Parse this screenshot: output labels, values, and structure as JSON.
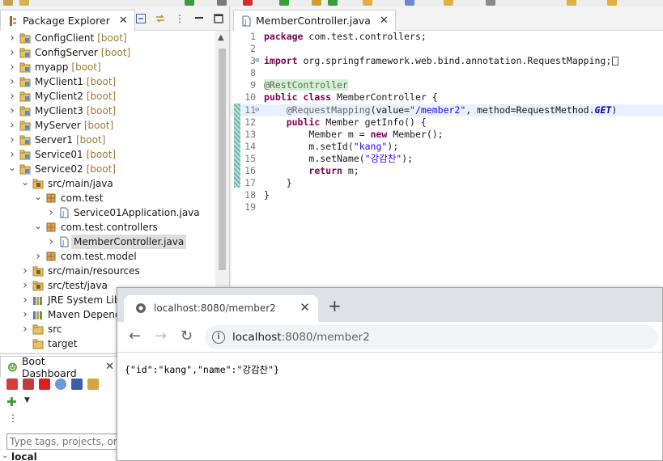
{
  "package_explorer": {
    "tab_label": "Package Explorer",
    "items": [
      {
        "label": "ConfigClient",
        "decoration": "[boot]",
        "indent": 0,
        "state": "collapsed",
        "icon": "project-icon"
      },
      {
        "label": "ConfigServer",
        "decoration": "[boot]",
        "indent": 0,
        "state": "collapsed",
        "icon": "project-icon"
      },
      {
        "label": "myapp",
        "decoration": "[boot]",
        "indent": 0,
        "state": "collapsed",
        "icon": "project-icon"
      },
      {
        "label": "MyClient1",
        "decoration": "[boot]",
        "indent": 0,
        "state": "collapsed",
        "icon": "project-icon"
      },
      {
        "label": "MyClient2",
        "decoration": "[boot]",
        "indent": 0,
        "state": "collapsed",
        "icon": "project-icon"
      },
      {
        "label": "MyClient3",
        "decoration": "[boot]",
        "indent": 0,
        "state": "collapsed",
        "icon": "project-icon"
      },
      {
        "label": "MyServer",
        "decoration": "[boot]",
        "indent": 0,
        "state": "collapsed",
        "icon": "project-icon"
      },
      {
        "label": "Server1",
        "decoration": "[boot]",
        "indent": 0,
        "state": "collapsed",
        "icon": "project-icon"
      },
      {
        "label": "Service01",
        "decoration": "[boot]",
        "indent": 0,
        "state": "collapsed",
        "icon": "project-icon"
      },
      {
        "label": "Service02",
        "decoration": "[boot]",
        "indent": 0,
        "state": "expanded",
        "icon": "project-icon"
      },
      {
        "label": "src/main/java",
        "decoration": "",
        "indent": 1,
        "state": "expanded",
        "icon": "source-folder-icon"
      },
      {
        "label": "com.test",
        "decoration": "",
        "indent": 2,
        "state": "expanded",
        "icon": "package-icon"
      },
      {
        "label": "Service01Application.java",
        "decoration": "",
        "indent": 3,
        "state": "collapsed",
        "icon": "java-file-icon"
      },
      {
        "label": "com.test.controllers",
        "decoration": "",
        "indent": 2,
        "state": "expanded",
        "icon": "package-icon"
      },
      {
        "label": "MemberController.java",
        "decoration": "",
        "indent": 3,
        "state": "collapsed",
        "icon": "java-file-icon",
        "selected": true
      },
      {
        "label": "com.test.model",
        "decoration": "",
        "indent": 2,
        "state": "collapsed",
        "icon": "package-icon"
      },
      {
        "label": "src/main/resources",
        "decoration": "",
        "indent": 1,
        "state": "collapsed",
        "icon": "source-folder-icon"
      },
      {
        "label": "src/test/java",
        "decoration": "",
        "indent": 1,
        "state": "collapsed",
        "icon": "source-folder-icon"
      },
      {
        "label": "JRE System Libra",
        "decoration": "",
        "indent": 1,
        "state": "collapsed",
        "icon": "library-icon"
      },
      {
        "label": "Maven Depende",
        "decoration": "",
        "indent": 1,
        "state": "collapsed",
        "icon": "library-icon"
      },
      {
        "label": "src",
        "decoration": "",
        "indent": 1,
        "state": "collapsed",
        "icon": "folder-icon"
      },
      {
        "label": "target",
        "decoration": "",
        "indent": 1,
        "state": "none",
        "icon": "folder-icon"
      }
    ]
  },
  "boot_dashboard": {
    "tab_label": "Boot Dashboard",
    "filter_placeholder": "Type tags, projects, or wo",
    "local_label": "local"
  },
  "editor": {
    "tab_label": "MemberController.java",
    "lines": [
      {
        "n": "1",
        "parts": [
          [
            "kw",
            "package"
          ],
          [
            "",
            "com.test.controllers;"
          ]
        ]
      },
      {
        "n": "2",
        "parts": []
      },
      {
        "n": "3",
        "fold": "⊕",
        "parts": [
          [
            "kw",
            "import"
          ],
          [
            "",
            "org.springframework.web.bind.annotation.RequestMapping;"
          ]
        ],
        "ext": true
      },
      {
        "n": "8",
        "parts": []
      },
      {
        "n": "9",
        "parts": [
          [
            "ann",
            "@RestController"
          ]
        ]
      },
      {
        "n": "10",
        "parts": [
          [
            "kw",
            "public"
          ],
          [
            "",
            ""
          ],
          [
            "kw",
            "class"
          ],
          [
            "",
            "MemberController {"
          ]
        ]
      },
      {
        "n": "11",
        "fold": "⊖",
        "hl": true,
        "indent": "    ",
        "parts": [
          [
            "ann2",
            "@RequestMapping"
          ],
          [
            "",
            "(value="
          ],
          [
            "str",
            "\"/member2\""
          ],
          [
            "",
            ", method=RequestMethod."
          ],
          [
            "ital",
            "GET"
          ],
          [
            "",
            ")"
          ]
        ]
      },
      {
        "n": "12",
        "indent": "    ",
        "parts": [
          [
            "kw",
            "public"
          ],
          [
            "",
            "Member getInfo() {"
          ]
        ]
      },
      {
        "n": "13",
        "indent": "        ",
        "parts": [
          [
            "",
            "Member m = "
          ],
          [
            "kw",
            "new"
          ],
          [
            "",
            "Member();"
          ]
        ]
      },
      {
        "n": "14",
        "indent": "        ",
        "parts": [
          [
            "",
            "m.setId("
          ],
          [
            "str",
            "\"kang\""
          ],
          [
            "",
            ");"
          ]
        ]
      },
      {
        "n": "15",
        "indent": "        ",
        "parts": [
          [
            "",
            "m.setName("
          ],
          [
            "str",
            "\"강감찬\""
          ],
          [
            "",
            ");"
          ]
        ]
      },
      {
        "n": "16",
        "indent": "        ",
        "parts": [
          [
            "kw",
            "return"
          ],
          [
            "",
            "m;"
          ]
        ]
      },
      {
        "n": "17",
        "indent": "    ",
        "parts": [
          [
            "",
            "}"
          ]
        ]
      },
      {
        "n": "18",
        "parts": [
          [
            "",
            "}"
          ]
        ]
      },
      {
        "n": "19",
        "parts": []
      }
    ]
  },
  "browser": {
    "tab_title": "localhost:8080/member2",
    "url_host": "localhost",
    "url_path": ":8080/member2",
    "body_text": "{\"id\":\"kang\",\"name\":\"강감찬\"}"
  },
  "colors": {
    "keyword": "#7f0055",
    "string": "#2a00ff",
    "annotation": "#646464",
    "selection": "#dddddd",
    "change_bar": "#6fb8b0"
  }
}
